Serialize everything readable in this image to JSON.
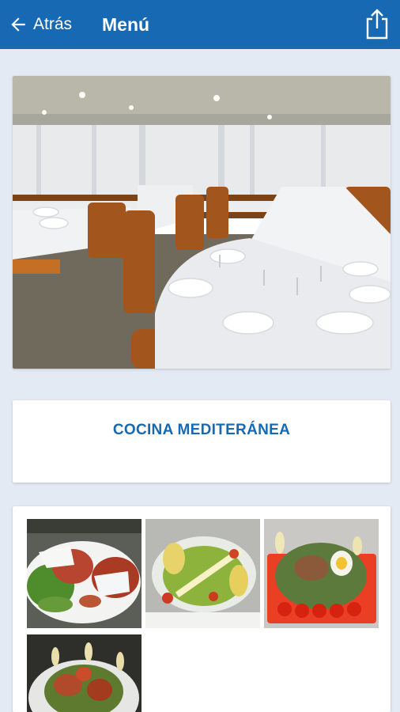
{
  "header": {
    "back_label": "Atrás",
    "title": "Menú",
    "share_icon": "share-icon",
    "background": "#1769b3"
  },
  "hero": {
    "image": "restaurant-dining-room-photo"
  },
  "cuisine": {
    "label": "COCINA MEDITERÁNEA",
    "color": "#1769b3"
  },
  "gallery": {
    "items": [
      {
        "image": "salad-with-cheese-and-tomato-photo"
      },
      {
        "image": "salad-with-pear-and-dressing-photo"
      },
      {
        "image": "salad-with-egg-and-tomatoes-photo"
      },
      {
        "image": "mixed-salad-photo"
      }
    ]
  }
}
